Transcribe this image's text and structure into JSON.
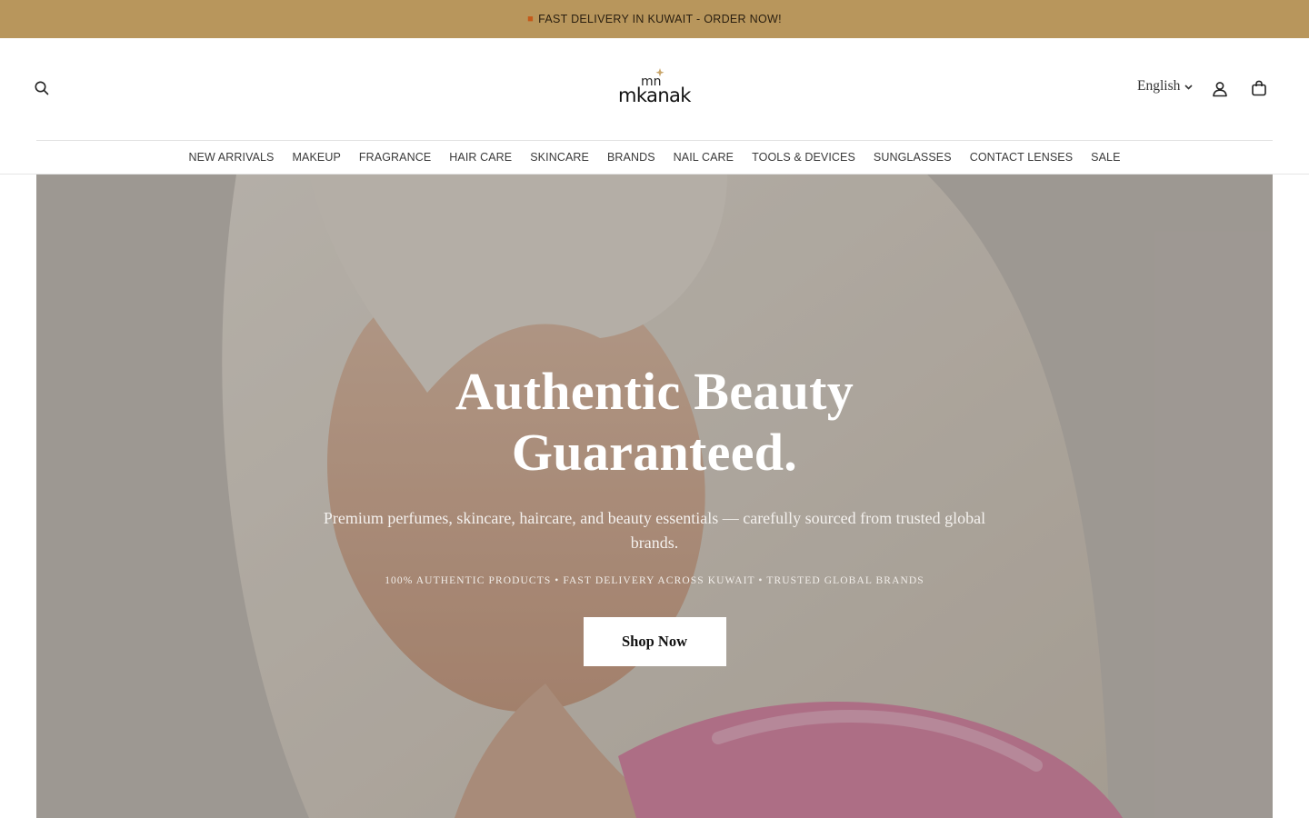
{
  "announcement": {
    "icon": "truck-icon",
    "text": "FAST DELIVERY IN KUWAIT - ORDER NOW!"
  },
  "header": {
    "logo_text": "mkanak",
    "logo_mark": "mn",
    "language": "English",
    "icons": [
      "search-icon",
      "account-icon",
      "cart-icon"
    ]
  },
  "nav": {
    "items": [
      "NEW ARRIVALS",
      "MAKEUP",
      "FRAGRANCE",
      "HAIR CARE",
      "SKINCARE",
      "BRANDS",
      "NAIL CARE",
      "TOOLS & DEVICES",
      "SUNGLASSES",
      "CONTACT LENSES",
      "SALE"
    ]
  },
  "hero": {
    "title": "Authentic Beauty Guaranteed.",
    "subtitle": "Premium perfumes, skincare, haircare, and beauty essentials — carefully sourced from trusted global brands.",
    "badges": "100% AUTHENTIC PRODUCTS • FAST DELIVERY ACROSS KUWAIT • TRUSTED GLOBAL BRANDS",
    "cta": "Shop Now"
  },
  "colors": {
    "announcement_bg": "#b8965c",
    "cta_bg": "#ffffff",
    "hero_text": "#ffffff"
  }
}
